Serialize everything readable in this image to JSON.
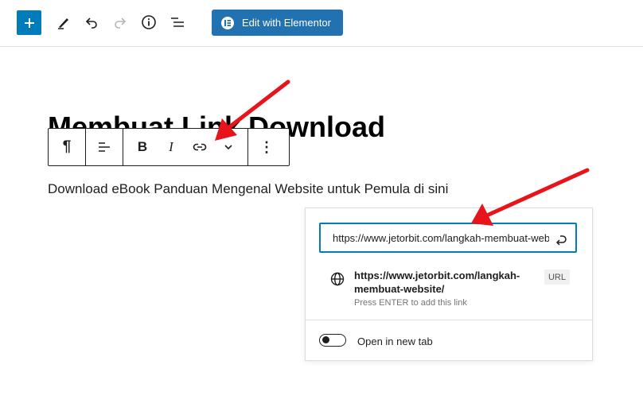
{
  "toolbar": {
    "elementor_label": "Edit with Elementor"
  },
  "block_toolbar": {
    "paragraph_glyph": "¶",
    "bold_label": "B",
    "italic_label": "I",
    "more_glyph": "⋮"
  },
  "post": {
    "title": "Membuat Link Download",
    "paragraph": "Download eBook Panduan Mengenal Website untuk Pemula di sini"
  },
  "link_popover": {
    "input_value": "https://www.jetorbit.com/langkah-membuat-website/",
    "suggestion_url": "https://www.jetorbit.com/langkah-membuat-website/",
    "suggestion_hint": "Press ENTER to add this link",
    "suggestion_badge": "URL",
    "open_new_tab_label": "Open in new tab"
  },
  "colors": {
    "accent": "#007cba",
    "elementor": "#2271b1",
    "arrow": "#e8141b"
  }
}
